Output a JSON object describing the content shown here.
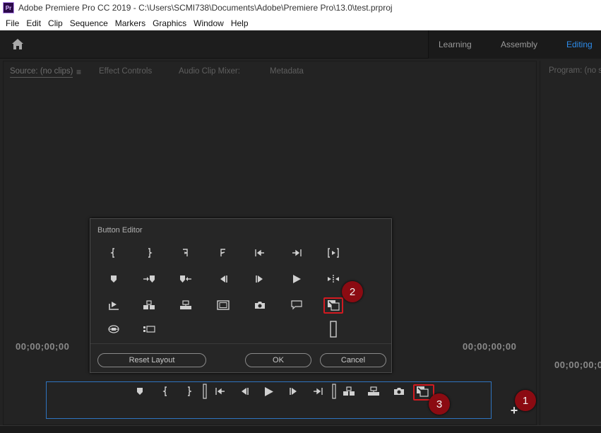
{
  "window": {
    "app_icon": "Pr",
    "title": "Adobe Premiere Pro CC 2019 - C:\\Users\\SCMI738\\Documents\\Adobe\\Premiere Pro\\13.0\\test.prproj"
  },
  "menu": [
    "File",
    "Edit",
    "Clip",
    "Sequence",
    "Markers",
    "Graphics",
    "Window",
    "Help"
  ],
  "header": {
    "home_icon": "home-icon",
    "workspaces": [
      "Learning",
      "Assembly",
      "Editing"
    ],
    "active_workspace": "Editing",
    "active_color": "#2d8ceb"
  },
  "source_panel": {
    "tabs": [
      "Source: (no clips)",
      "Effect Controls",
      "Audio Clip Mixer:",
      "Metadata"
    ],
    "timecode_left": "00;00;00;00",
    "timecode_right": "00;00;00;00"
  },
  "program_panel": {
    "tab": "Program: (no s",
    "timecode": "00;00;00;00"
  },
  "button_editor": {
    "title": "Button Editor",
    "rows": [
      [
        "mark-in-icon",
        "mark-out-icon",
        "mark-clip-icon",
        "go-to-in-icon",
        "go-to-previous-edit-icon",
        "go-to-next-edit-icon",
        "play-in-to-out-icon"
      ],
      [
        "add-marker-icon",
        "go-to-next-marker-icon",
        "go-to-previous-marker-icon",
        "step-back-icon",
        "step-forward-icon",
        "play-icon",
        "shuttle-icon"
      ],
      [
        "play-around-icon",
        "insert-icon",
        "overwrite-icon",
        "safe-margins-icon",
        "export-frame-icon",
        "closed-captions-icon",
        "toggle-proxies-icon"
      ],
      [
        "vr-video-icon",
        "multi-camera-icon",
        "",
        "",
        "",
        "",
        "spacer-icon"
      ]
    ],
    "reset_label": "Reset Layout",
    "ok_label": "OK",
    "cancel_label": "Cancel"
  },
  "button_bar": {
    "buttons": [
      "add-marker-icon",
      "mark-in-icon",
      "mark-out-icon",
      "spacer-icon",
      "go-to-in-icon",
      "step-back-icon",
      "play-icon",
      "step-forward-icon",
      "go-to-out-icon",
      "spacer-icon",
      "insert-icon",
      "overwrite-icon",
      "export-frame-icon",
      "toggle-proxies-icon"
    ]
  },
  "plus_button": "+",
  "callouts": [
    "1",
    "2",
    "3"
  ],
  "callout_color": "#8b0b12"
}
